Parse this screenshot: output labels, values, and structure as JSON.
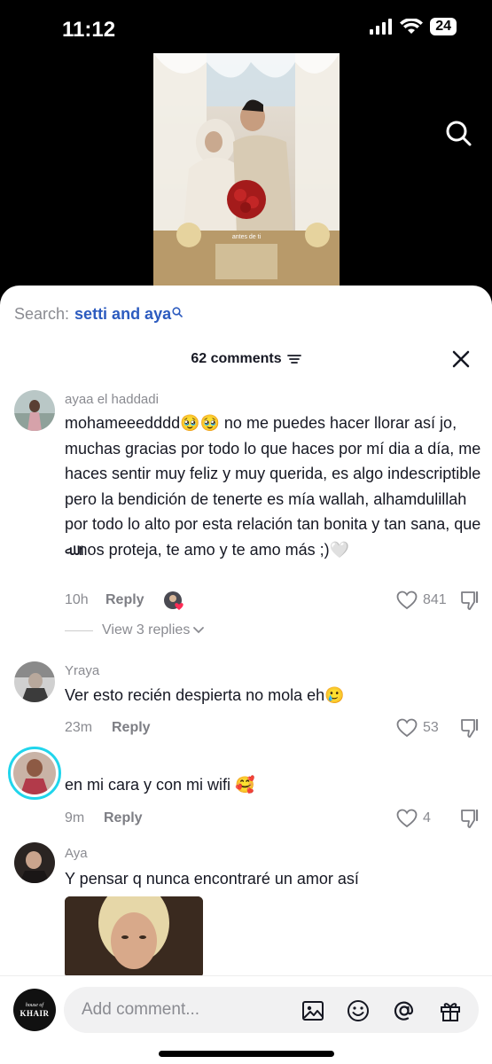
{
  "status_bar": {
    "time": "11:12",
    "battery": "24"
  },
  "video": {
    "caption": "antes de ti"
  },
  "search": {
    "prefix": "Search:",
    "term": "setti and aya"
  },
  "comments_header": {
    "count_label": "62 comments"
  },
  "comments": [
    {
      "username": "ayaa el haddadi",
      "text": "mohameeedddd🥹🥹 no me puedes hacer llorar así jo, muchas gracias por todo lo que haces por mí dia a día, me haces sentir muy feliz y muy querida, es algo indescriptible pero la bendición de tenerte es mía wallah, alhamdulillah por todo lo alto por esta relación tan bonita y tan sana, que ﷲ nos proteja, te amo y te amo más ;)🤍",
      "time": "10h",
      "reply": "Reply",
      "likes": "841",
      "view_replies": "View 3 replies"
    },
    {
      "username": "Yraya",
      "text": "Ver esto recién despierta no mola eh🥲",
      "time": "23m",
      "reply": "Reply",
      "likes": "53"
    },
    {
      "username": "",
      "text": "en mi cara y con mi wifi 🥰",
      "time": "9m",
      "reply": "Reply",
      "likes": "4"
    },
    {
      "username": "Aya",
      "text": "Y pensar q nunca encontraré un amor así"
    }
  ],
  "bottom_bar": {
    "brand_small": "house of",
    "brand_main": "KHAIR",
    "placeholder": "Add comment..."
  },
  "colors": {
    "accent_blue": "#2c5bbf",
    "muted": "#8a8b91",
    "text": "#161823",
    "story_ring": "#20d5ec"
  }
}
